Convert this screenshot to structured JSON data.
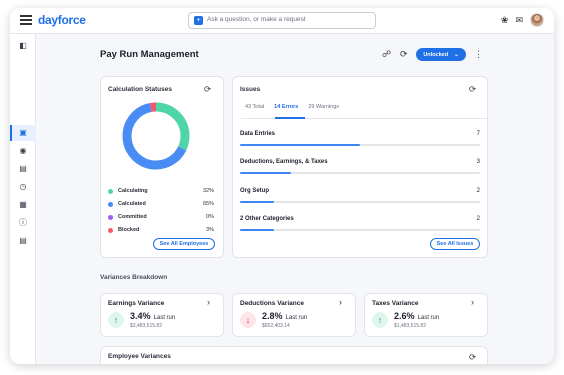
{
  "app": {
    "logo": "dayforce"
  },
  "search": {
    "placeholder": "Ask a question, or make a request"
  },
  "page": {
    "title": "Pay Run Management",
    "status_button": "Unlocked"
  },
  "calculation": {
    "title": "Calculation Statuses",
    "items": [
      {
        "label": "Calculating",
        "pct": "32%",
        "value": 32,
        "color": "#4fd6a8"
      },
      {
        "label": "Calculated",
        "pct": "65%",
        "value": 65,
        "color": "#4a8cf5"
      },
      {
        "label": "Committed",
        "pct": "0%",
        "value": 0,
        "color": "#a55cf0"
      },
      {
        "label": "Blocked",
        "pct": "3%",
        "value": 3,
        "color": "#f25a6b"
      }
    ],
    "button": "See All Employees"
  },
  "issues": {
    "title": "Issues",
    "tabs": [
      "43 Total",
      "14 Errors",
      "29 Warnings"
    ],
    "rows": [
      {
        "label": "Data Entries",
        "count": "7",
        "value": 7
      },
      {
        "label": "Deductions, Earnings, & Taxes",
        "count": "3",
        "value": 3
      },
      {
        "label": "Org Setup",
        "count": "2",
        "value": 2
      },
      {
        "label": "2 Other Categories",
        "count": "2",
        "value": 2
      }
    ],
    "max": 14,
    "button": "See All Issues"
  },
  "variances": {
    "title": "Variances Breakdown",
    "cards": [
      {
        "title": "Earnings Variance",
        "pct": "3.4%",
        "last": "Last run",
        "amount": "$3,483,515.82",
        "direction": "up"
      },
      {
        "title": "Deductions Variance",
        "pct": "2.8%",
        "last": "Last run",
        "amount": "$652,403.14",
        "direction": "down"
      },
      {
        "title": "Taxes Variance",
        "pct": "2.6%",
        "last": "Last run",
        "amount": "$1,483,515.82",
        "direction": "up"
      }
    ]
  },
  "employee_variances": {
    "title": "Employee Variances"
  },
  "colors": {
    "accent": "#1f6fe5",
    "up_bg": "#dff6ec",
    "up_fg": "#1aa06b",
    "down_bg": "#fde4e6",
    "down_fg": "#d93447"
  }
}
